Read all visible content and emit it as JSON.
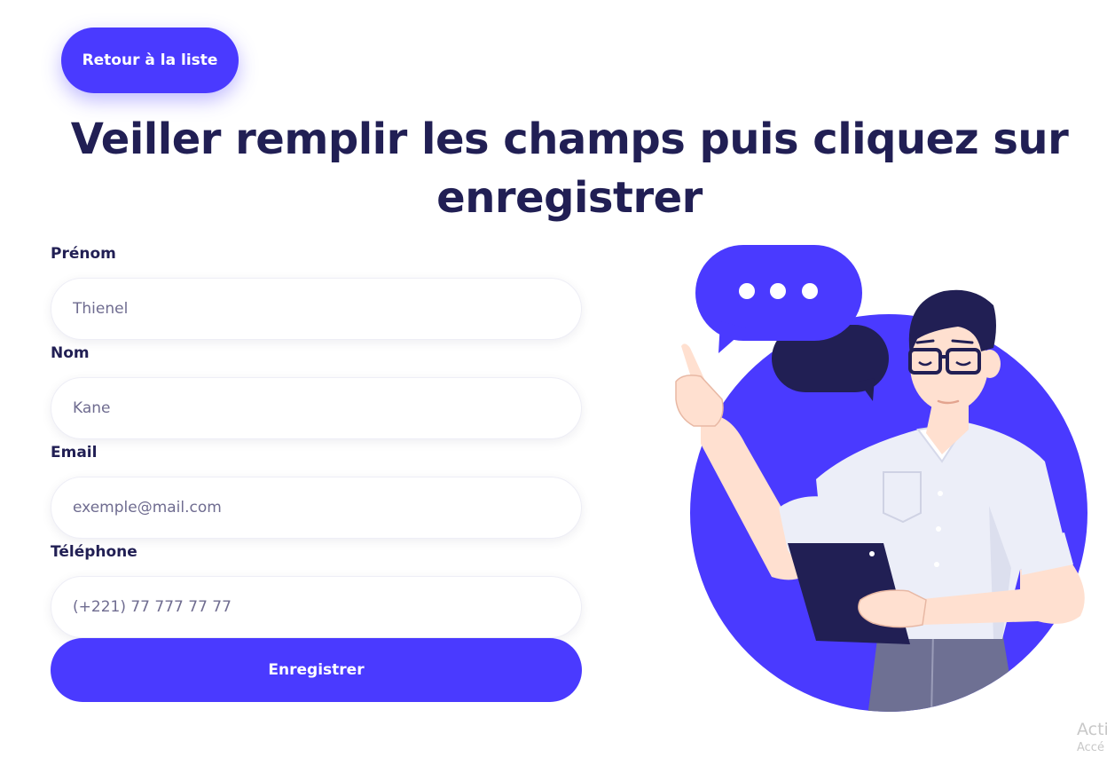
{
  "header": {
    "back_button_label": "Retour à la liste",
    "title": "Veiller remplir les champs puis cliquez sur enregistrer"
  },
  "form": {
    "fields": [
      {
        "label": "Prénom",
        "placeholder": "Thienel",
        "value": ""
      },
      {
        "label": "Nom",
        "placeholder": "Kane",
        "value": ""
      },
      {
        "label": "Email",
        "placeholder": "exemple@mail.com",
        "value": ""
      },
      {
        "label": "Téléphone",
        "placeholder": "(+221) 77 777 77 77",
        "value": ""
      }
    ],
    "submit_label": "Enregistrer"
  },
  "illustration": {
    "icon": "person-with-speech-bubbles-illustration",
    "accent_color": "#4a3aff",
    "dark_color": "#211f54"
  },
  "watermark": {
    "line1": "Acti",
    "line2": "Accé"
  },
  "colors": {
    "primary": "#4a3aff",
    "heading": "#211f54",
    "placeholder": "#6f6c90"
  }
}
